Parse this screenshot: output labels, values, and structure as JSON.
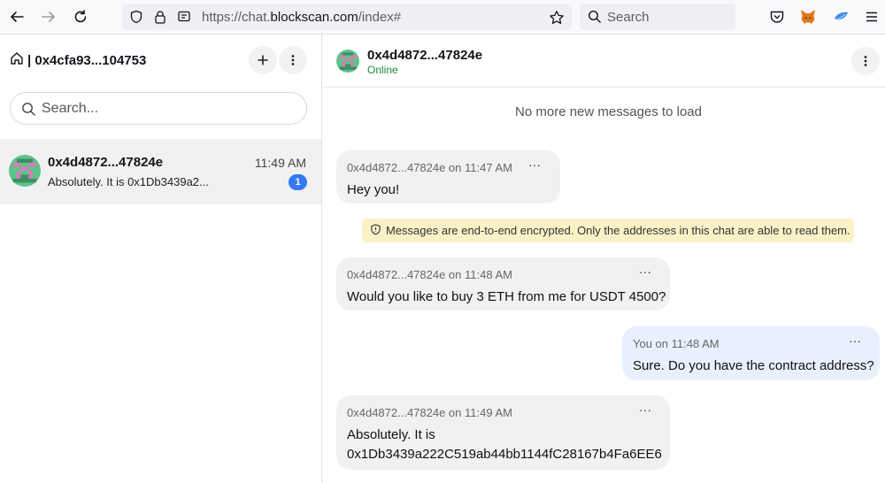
{
  "browser": {
    "url_scheme": "https://chat.",
    "url_host": "blockscan.com",
    "url_path": "/index#",
    "search_placeholder": "Search"
  },
  "sidebar": {
    "title": "| 0x4cfa93...104753",
    "search_placeholder": "Search...",
    "conversations": [
      {
        "name": "0x4d4872...47824e",
        "time": "11:49 AM",
        "preview": "Absolutely. It is 0x1Db3439a2...",
        "unread": "1"
      }
    ]
  },
  "chat": {
    "contact_name": "0x4d4872...47824e",
    "status": "Online",
    "no_more_text": "No more new messages to load",
    "encryption_notice": "Messages are end-to-end encrypted. Only the addresses in this chat are able to read them.",
    "messages": [
      {
        "meta": "0x4d4872...47824e on 11:47 AM",
        "text": "Hey you!",
        "mine": false
      },
      {
        "meta": "0x4d4872...47824e on 11:48 AM",
        "text": "Would you like to buy 3 ETH from me for USDT 4500?",
        "mine": false
      },
      {
        "meta": "You on 11:48 AM",
        "text": "Sure. Do you have the contract address?",
        "mine": true
      },
      {
        "meta": "0x4d4872...47824e on 11:49 AM",
        "text_line1": "Absolutely. It is",
        "text_line2": "0x1Db3439a222C519ab44bb1144fC28167b4Fa6EE6",
        "mine": false
      }
    ],
    "more_label": "···"
  },
  "icons": {
    "back": "back-arrow-icon",
    "forward": "forward-arrow-icon",
    "reload": "reload-icon",
    "shield": "shield-icon",
    "lock": "lock-icon",
    "reader": "reader-icon",
    "star": "star-icon",
    "pocket": "pocket-icon",
    "metamask": "metamask-fox-icon",
    "extension": "extension-icon",
    "menu": "hamburger-menu-icon"
  },
  "colors": {
    "accent": "#3478f6",
    "online": "#1e8a3c",
    "notice_bg": "#fbf1c7",
    "my_bubble": "#e9f0fd",
    "their_bubble": "#f1f1f1"
  }
}
